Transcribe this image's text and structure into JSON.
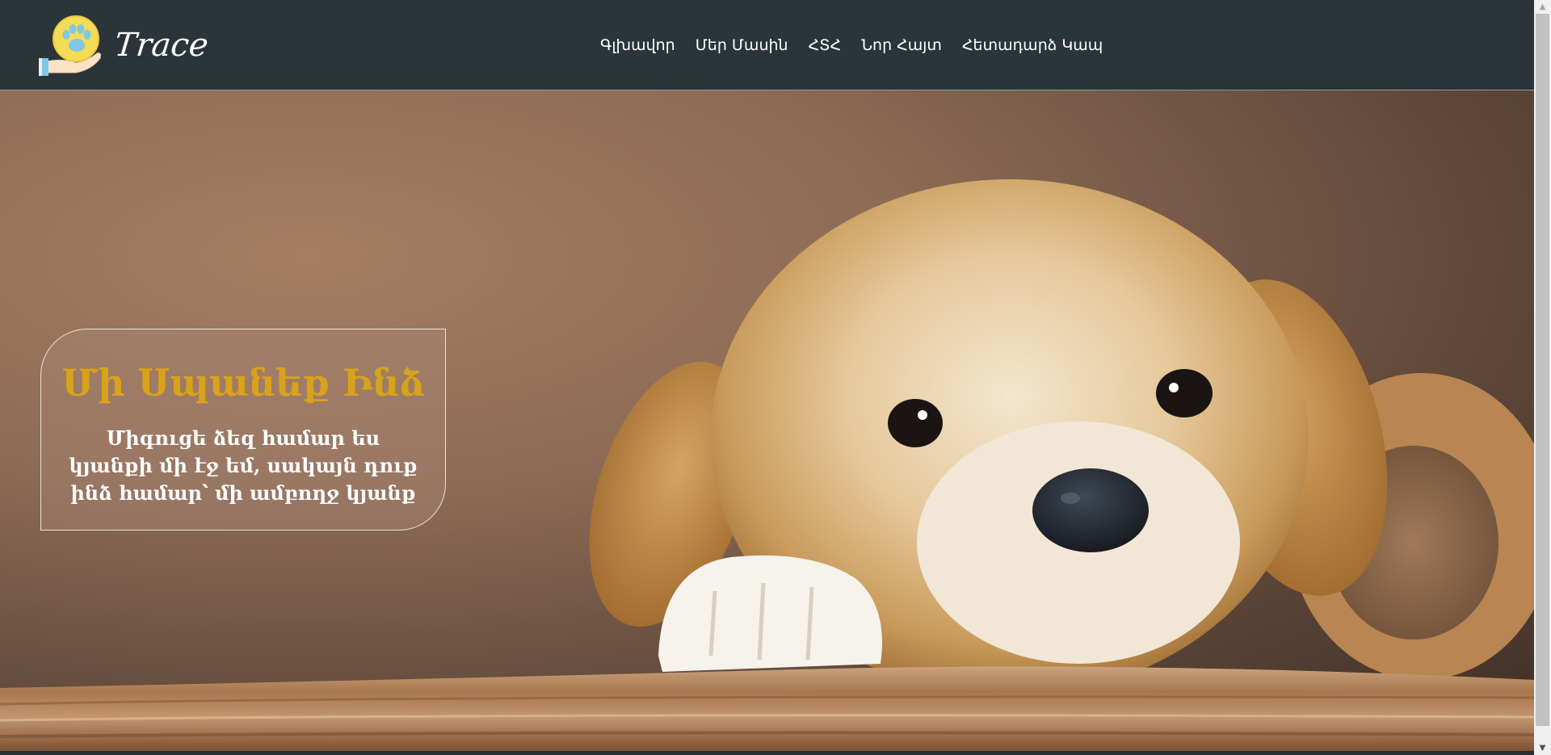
{
  "header": {
    "logo_text": "Trace",
    "nav": [
      {
        "label": "Գլխավոր"
      },
      {
        "label": "Մեր Մասին"
      },
      {
        "label": "ՀՏՀ"
      },
      {
        "label": "Նոր Հայտ"
      },
      {
        "label": "Հետադարձ Կապ"
      }
    ]
  },
  "hero": {
    "title": "Մի Սպանեք Ինձ",
    "text": "Միգուցե ձեզ համար ես կյանքի մի էջ եմ, սակայն դուք ինձ համար՝ մի ամբողջ կյանք"
  },
  "colors": {
    "header_bg": "#2b3438",
    "title_accent": "#d9a21b",
    "nav_text": "#ffffff"
  },
  "icons": {
    "logo": "paw-in-hand-icon",
    "scroll_up": "arrow-up-icon",
    "scroll_down": "arrow-down-icon"
  }
}
